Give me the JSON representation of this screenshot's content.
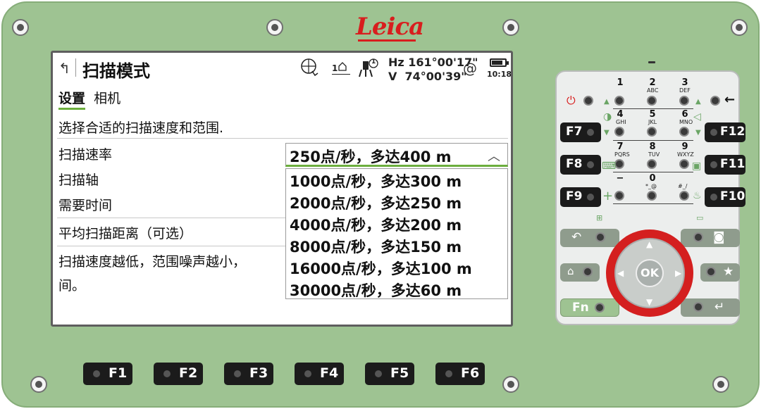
{
  "device": {
    "brand": "Leica",
    "accent_red": "#d81e1e",
    "body_color": "#9ec392"
  },
  "screen": {
    "title": "扫描模式",
    "status": {
      "hz_label": "Hz",
      "hz_value": "161°00'17\"",
      "v_label": "V",
      "v_value": "74°00'39\"",
      "at_symbol": "@",
      "time": "10:18",
      "battery_level": 0.85,
      "prism_count": "1",
      "face_count": "1"
    },
    "tabs": [
      {
        "label": "设置",
        "active": true
      },
      {
        "label": "相机",
        "active": false
      }
    ],
    "description": "选择合适的扫描速度和范围.",
    "fields": {
      "scan_rate_label": "扫描速率",
      "scan_axis_label": "扫描轴",
      "time_needed_label": "需要时间",
      "avg_distance_label": "平均扫描距离（可选）"
    },
    "note_line1": "扫描速度越低，范围噪声越小，",
    "note_line2": "间。",
    "dropdown": {
      "selected": "250点/秒，多达400 m",
      "options": [
        "1000点/秒，多达300 m",
        "2000点/秒，多达250 m",
        "4000点/秒，多达200 m",
        "8000点/秒，多达150 m",
        "16000点/秒，多达100 m",
        "30000点/秒，多达60 m"
      ]
    }
  },
  "keypad": {
    "keys": [
      {
        "num": "1",
        "sub": ""
      },
      {
        "num": "2",
        "sub": "ABC"
      },
      {
        "num": "3",
        "sub": "DEF"
      },
      {
        "num": "4",
        "sub": "GHI"
      },
      {
        "num": "5",
        "sub": "JKL"
      },
      {
        "num": "6",
        "sub": "MNO"
      },
      {
        "num": "7",
        "sub": "PQRS"
      },
      {
        "num": "8",
        "sub": "TUV"
      },
      {
        "num": "9",
        "sub": "WXYZ"
      },
      {
        "num": "−",
        "sub": ""
      },
      {
        "num": "0",
        "sub": "*_@"
      },
      {
        "num": "",
        "sub": "#_/"
      }
    ],
    "side_fkeys": [
      "F7",
      "F8",
      "F9",
      "F12",
      "F11",
      "F10"
    ],
    "ok_label": "OK",
    "fn_label": "Fn"
  },
  "bottom_fkeys": [
    "F1",
    "F2",
    "F3",
    "F4",
    "F5",
    "F6"
  ]
}
